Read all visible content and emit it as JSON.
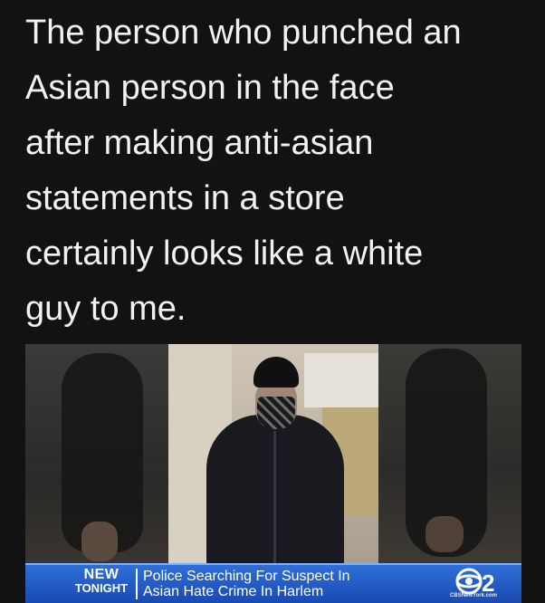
{
  "post": {
    "text_lines": [
      "The person who punched an",
      "Asian person in the face",
      "after making anti-asian",
      "statements in a store",
      "certainly looks like a white",
      "guy to me."
    ]
  },
  "news_image": {
    "tag_line1": "NEW",
    "tag_line2": "TONIGHT",
    "headline_line1": "Police Searching For Suspect In",
    "headline_line2": "Asian Hate Crime In Harlem",
    "station_logo": "C2",
    "website": "CBSNewYork.com",
    "ticker_color": "#1f56c2"
  }
}
